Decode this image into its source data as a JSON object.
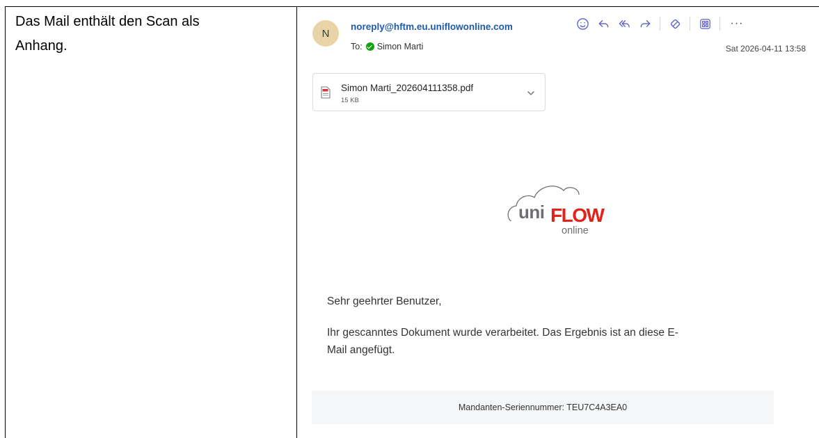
{
  "caption": {
    "line1": "Das Mail enthält den Scan als",
    "line2": "Anhang."
  },
  "email": {
    "avatar_initial": "N",
    "sender": "noreply@hftm.eu.uniflowonline.com",
    "to_label": "To:",
    "recipient": "Simon Marti",
    "datetime": "Sat 2026-04-11 13:58",
    "toolbar": {
      "icons": [
        "smiley-icon",
        "reply-icon",
        "reply-all-icon",
        "forward-icon",
        "link-icon",
        "apps-icon",
        "more-icon"
      ],
      "more_label": "···"
    },
    "attachment": {
      "filename": "Simon Marti_202604111358.pdf",
      "size": "15 KB"
    },
    "logo": {
      "uni": "uni",
      "flow": "FLOW",
      "online": "online"
    },
    "greeting": "Sehr geehrter Benutzer,",
    "paragraph_line1": "Ihr gescanntes Dokument wurde verarbeitet. Das Ergebnis ist an diese E-",
    "paragraph_line2": "Mail angefügt.",
    "footer": "Mandanten-Seriennummer: TEU7C4A3EA0"
  },
  "colors": {
    "accent": "#5b5fc7",
    "sender_link": "#1f5ba8",
    "logo_red": "#e2231a",
    "logo_gray": "#6d6e71",
    "presence_green": "#13a10e"
  }
}
